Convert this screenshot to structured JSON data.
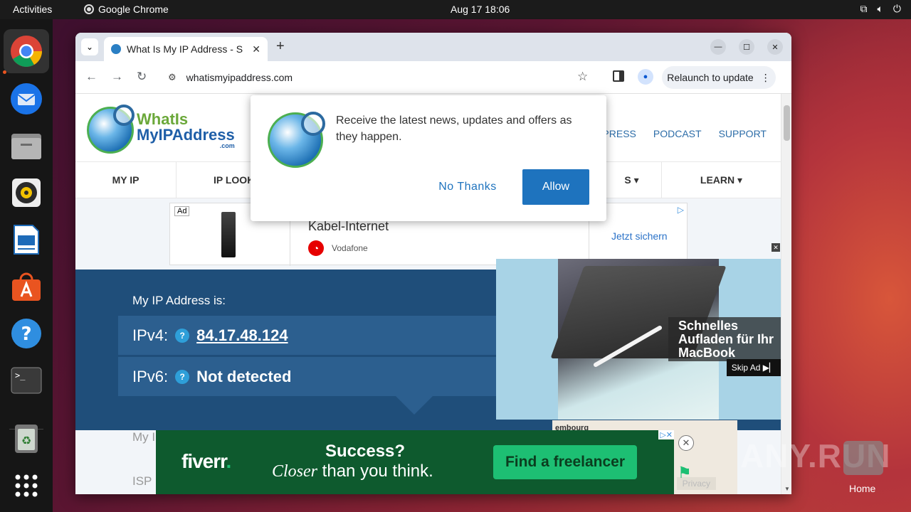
{
  "topbar": {
    "activities": "Activities",
    "app_name": "Google Chrome",
    "clock": "Aug 17  18:06",
    "tray_icons": [
      "network-icon",
      "volume-icon",
      "power-icon"
    ]
  },
  "dock": {
    "items": [
      "chrome",
      "thunderbird",
      "files",
      "rhythmbox",
      "libreoffice-writer",
      "app-center",
      "help",
      "terminal",
      "trash",
      "show-apps"
    ]
  },
  "browser": {
    "tab_title": "What Is My IP Address - S",
    "url": "whatismyipaddress.com",
    "relaunch_label": "Relaunch to update"
  },
  "site": {
    "logo_line1": "WhatIs",
    "logo_line2": "MyIPAddress",
    "logo_line3": ".com",
    "header_links": [
      "PRESS",
      "PODCAST",
      "SUPPORT"
    ],
    "nav": [
      "MY IP",
      "IP LOOK",
      "S ▾",
      "LEARN ▾"
    ]
  },
  "ad_strip": {
    "ad_label": "Ad",
    "title": "Kabel-Internet",
    "advertiser": "Vodafone",
    "cta": "Jetzt sichern"
  },
  "ip_panel": {
    "heading": "My IP Address is:",
    "ipv4_label": "IPv4:",
    "ipv4_value": "84.17.48.124",
    "ipv6_label": "IPv6:",
    "ipv6_value": "Not detected",
    "help_glyph": "?"
  },
  "lower": {
    "ghost1": "My I",
    "ghost2": "ISP",
    "map_label": "embourg",
    "privacy": "Privacy"
  },
  "notification": {
    "message": "Receive the latest news, updates and offers as they happen.",
    "no_thanks": "No Thanks",
    "allow": "Allow"
  },
  "video_ad": {
    "caption": "Schnelles Aufladen für Ihr MacBook",
    "skip": "Skip Ad ▶▏"
  },
  "fiverr": {
    "brand": "fiverr",
    "headline1": "Success?",
    "headline2_italic": "Closer",
    "headline2_rest": " than you think.",
    "cta": "Find a freelancer"
  },
  "watermark": "ANY.RUN",
  "home_label": "Home",
  "colors": {
    "ubuntu_orange": "#e95420",
    "site_blue": "#1f4e7a",
    "allow_blue": "#1e73be",
    "fiverr_green": "#1dbf73"
  }
}
